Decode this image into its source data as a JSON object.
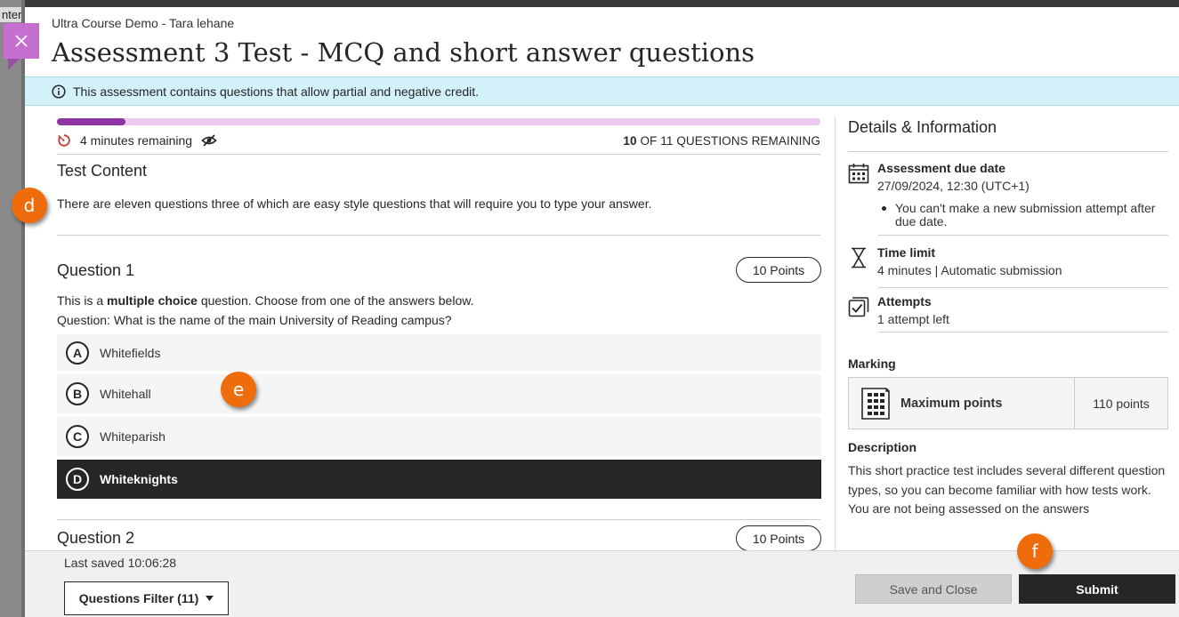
{
  "background": {
    "peek_text": "nter"
  },
  "header": {
    "course_name": "Ultra Course Demo - Tara lehane",
    "title": "Assessment 3 Test - MCQ and short answer questions",
    "close_icon": "close-icon"
  },
  "banner": {
    "icon": "info-icon",
    "text": "This assessment contains questions that allow partial and negative credit."
  },
  "progress": {
    "fraction": 0.09,
    "timer_text": "4 minutes remaining",
    "remaining_count": "10",
    "remaining_label": " OF 11 QUESTIONS REMAINING"
  },
  "content": {
    "title": "Test Content",
    "description": "There are eleven questions three of which are easy style questions that will require you to type your answer."
  },
  "question1": {
    "title": "Question 1",
    "points": "10 Points",
    "text_prefix": "This is a ",
    "text_bold": "multiple choice",
    "text_suffix": " question. Choose from one of the answers below.",
    "question_line": "Question: What is the name of the main University of Reading campus?",
    "answers": [
      {
        "letter": "A",
        "label": "Whitefields",
        "selected": false
      },
      {
        "letter": "B",
        "label": "Whitehall",
        "selected": false
      },
      {
        "letter": "C",
        "label": "Whiteparish",
        "selected": false
      },
      {
        "letter": "D",
        "label": "Whiteknights",
        "selected": true
      }
    ]
  },
  "question2": {
    "title": "Question 2",
    "points": "10 Points"
  },
  "sidebar": {
    "title": "Details & Information",
    "due": {
      "heading": "Assessment due date",
      "value": "27/09/2024, 12:30 (UTC+1)",
      "note": "You can't make a new submission attempt after due date."
    },
    "time_limit": {
      "heading": "Time limit",
      "value": "4 minutes | Automatic submission"
    },
    "attempts": {
      "heading": "Attempts",
      "value": "1 attempt left"
    },
    "marking": {
      "label": "Marking",
      "item": "Maximum points",
      "value": "110 points"
    },
    "description": {
      "label": "Description",
      "text": "This short practice test includes several different question types, so you can become familiar with how tests work. You are not being assessed on the answers"
    }
  },
  "footer": {
    "last_saved": "Last saved 10:06:28",
    "filter_label": "Questions Filter (11)",
    "save_label": "Save and Close",
    "submit_label": "Submit"
  },
  "markers": {
    "d": "d",
    "e": "e",
    "f": "f"
  },
  "colors": {
    "accent": "#8e35a3",
    "close_button": "#c56fd1",
    "banner_bg": "#d3f1f9",
    "marker": "#ee6c0b",
    "selected_answer": "#262626"
  }
}
